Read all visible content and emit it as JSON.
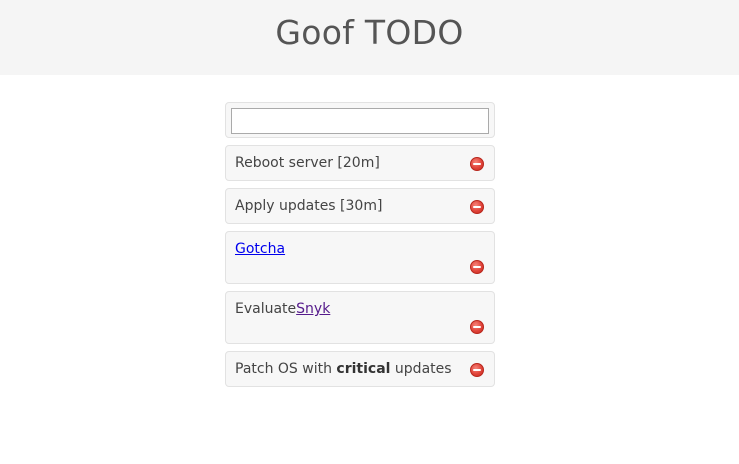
{
  "app": {
    "title": "Goof TODO"
  },
  "new_todo": {
    "value": "",
    "placeholder": ""
  },
  "todos": [
    {
      "text": "Reboot server [20m]"
    },
    {
      "text": "Apply updates [30m]"
    },
    {
      "link": "Gotcha"
    },
    {
      "prefix": "Evaluate",
      "link": "Snyk"
    },
    {
      "before": "Patch OS with ",
      "bold": "critical",
      "after": " updates"
    }
  ],
  "icons": {
    "delete": "remove-circle-icon"
  },
  "colors": {
    "delete_icon": "#e0443a",
    "header_bg": "#f5f5f5",
    "link": "#0000ee",
    "visited_link": "#551a8b"
  }
}
